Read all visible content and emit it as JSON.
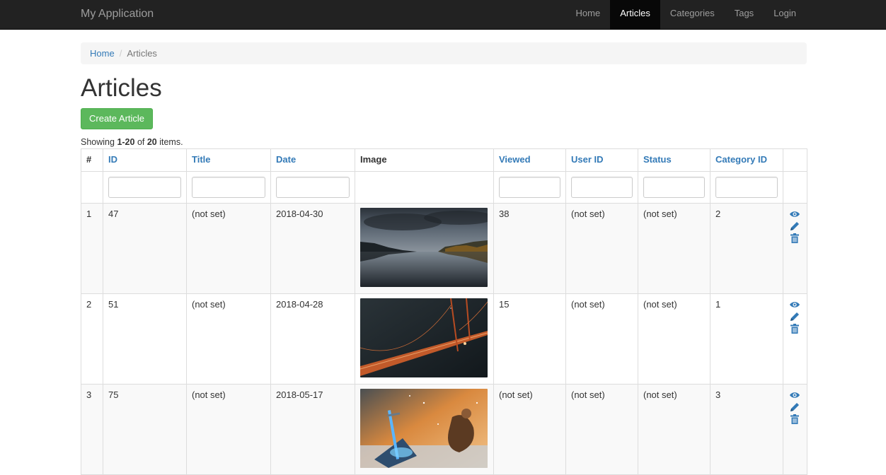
{
  "navbar": {
    "brand": "My Application",
    "items": [
      {
        "label": "Home",
        "active": false
      },
      {
        "label": "Articles",
        "active": true
      },
      {
        "label": "Categories",
        "active": false
      },
      {
        "label": "Tags",
        "active": false
      },
      {
        "label": "Login",
        "active": false
      }
    ]
  },
  "breadcrumb": {
    "home": "Home",
    "current": "Articles"
  },
  "page": {
    "title": "Articles",
    "create_button": "Create Article"
  },
  "summary": {
    "prefix": "Showing ",
    "range": "1-20",
    "middle": " of ",
    "total": "20",
    "suffix": " items."
  },
  "table": {
    "columns": [
      "#",
      "ID",
      "Title",
      "Date",
      "Image",
      "Viewed",
      "User ID",
      "Status",
      "Category ID"
    ],
    "rows": [
      {
        "num": "1",
        "id": "47",
        "title": "(not set)",
        "date": "2018-04-30",
        "image": "lake-landscape",
        "viewed": "38",
        "user_id": "(not set)",
        "status": "(not set)",
        "category_id": "2"
      },
      {
        "num": "2",
        "id": "51",
        "title": "(not set)",
        "date": "2018-04-28",
        "image": "bridge-at-night",
        "viewed": "15",
        "user_id": "(not set)",
        "status": "(not set)",
        "category_id": "1"
      },
      {
        "num": "3",
        "id": "75",
        "title": "(not set)",
        "date": "2018-05-17",
        "image": "fantasy-warrior-sword",
        "viewed": "(not set)",
        "user_id": "(not set)",
        "status": "(not set)",
        "category_id": "3"
      }
    ]
  },
  "icons": {
    "view": "eye-icon",
    "update": "pencil-icon",
    "delete": "trash-icon"
  },
  "colors": {
    "navbar_bg": "#222222",
    "link": "#337ab7",
    "success": "#5cb85c"
  }
}
